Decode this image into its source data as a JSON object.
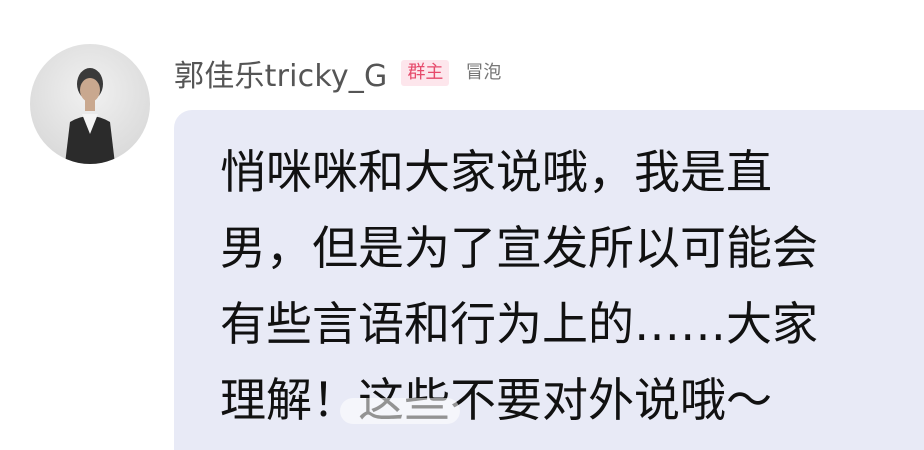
{
  "comment": {
    "username": "郭佳乐tricky_G",
    "role_badge": "群主",
    "bubble_badge": "冒泡",
    "message_lines": [
      "悄咪咪和大家说哦，我是直",
      "男，但是为了宣发所以可能会",
      "有些言语和行为上的……大家",
      "理解！这些不要对外说哦～"
    ]
  },
  "colors": {
    "bubble_bg": "#e8eaf6",
    "role_badge_text": "#e64a6b",
    "role_badge_bg": "#fde6ec"
  }
}
